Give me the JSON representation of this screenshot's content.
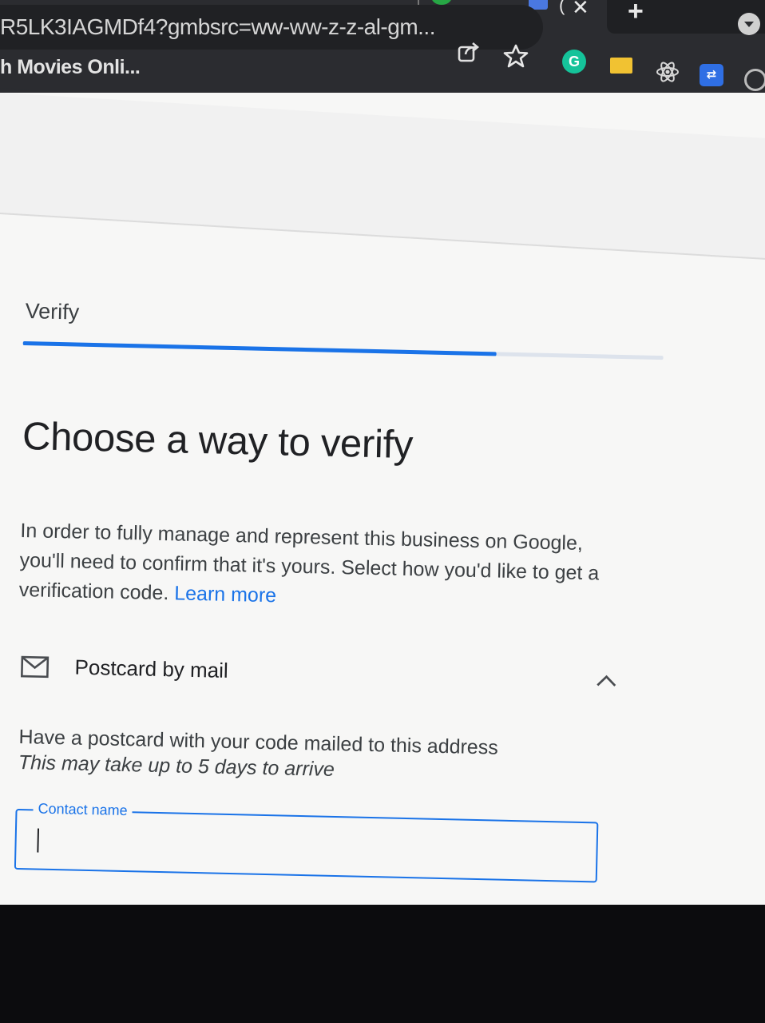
{
  "browser": {
    "url": "R5LK3IAGMDf4?gmbsrc=ww-ww-z-z-al-gm...",
    "bookmark": "h Movies Onli...",
    "new_tab": "+",
    "tab_close": "✕",
    "extensions": [
      "grammarly-icon",
      "folder-icon",
      "react-devtools-icon",
      "link-extension-icon",
      "circle-extension-icon"
    ]
  },
  "verify": {
    "step_label": "Verify",
    "progress_percent": 74,
    "headline": "Choose a way to verify",
    "description": "In order to fully manage and represent this business on Google, you'll need to confirm that it's yours. Select how you'd like to get a verification code.",
    "learn_more": "Learn more",
    "option": {
      "icon": "mail-icon",
      "title": "Postcard by mail",
      "description": "Have a postcard with your code mailed to this address",
      "note": "This may take up to 5 days to arrive",
      "expanded": true
    },
    "contact_field": {
      "label": "Contact name",
      "value": ""
    }
  },
  "colors": {
    "accent": "#1a73e8",
    "chrome": "#2b2c30",
    "page": "#f7f7f6"
  }
}
